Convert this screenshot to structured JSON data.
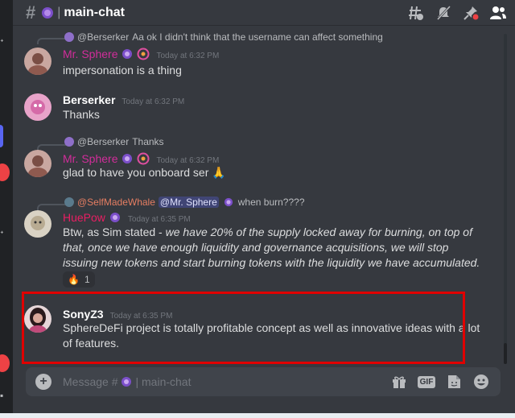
{
  "channel": {
    "name": "main-chat"
  },
  "header_icons": [
    "threads-icon",
    "notification-bell-muted-icon",
    "pin-icon",
    "member-list-icon"
  ],
  "messages": [
    {
      "reply": {
        "to": "@Berserker",
        "text": "Aa ok I didn't think that the username can affect something"
      },
      "author": "Mr. Sphere",
      "timestamp": "Today at 6:32 PM",
      "content": "impersonation is a thing"
    },
    {
      "author": "Berserker",
      "timestamp": "Today at 6:32 PM",
      "content": "Thanks"
    },
    {
      "reply": {
        "to": "@Berserker",
        "text": "Thanks"
      },
      "author": "Mr. Sphere",
      "timestamp": "Today at 6:32 PM",
      "content": "glad to have you onboard ser",
      "emoji": "🙏"
    },
    {
      "reply": {
        "to": "@SelfMadeWhale",
        "mention": "@Mr. Sphere",
        "text": "when burn????"
      },
      "author": "HuePow",
      "timestamp": "Today at 6:35 PM",
      "content_prefix": "Btw, as Sim stated - ",
      "content_italic": "we have 20% of the supply locked away for burning, on top of that, once we have enough liquidity and governance acquisitions, we will stop issuing new tokens and start burning tokens with the liquidity we have accumulated.",
      "reaction": {
        "emoji": "🔥",
        "count": "1"
      }
    },
    {
      "author": "SonyZ3",
      "timestamp": "Today at 6:35 PM",
      "content": "SphereDeFi project is totally profitable concept as well as innovative ideas with a lot of features."
    }
  ],
  "composer": {
    "placeholder_prefix": "Message #",
    "placeholder_channel": "| main-chat",
    "gif_label": "GIF"
  },
  "colors": {
    "background": "#36393f",
    "highlight_box": "#e00000",
    "mr_sphere": "#d12d9a",
    "huepow": "#e91e63"
  }
}
